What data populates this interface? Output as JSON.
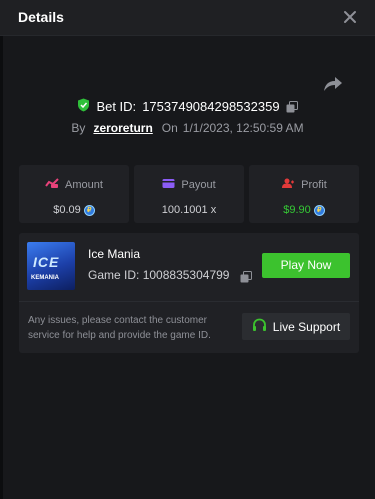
{
  "header": {
    "title": "Details"
  },
  "bet": {
    "label": "Bet ID:",
    "id": "1753749084298532359",
    "by_label": "By",
    "user": "zeroreturn",
    "on_label": "On",
    "datetime": "1/1/2023, 12:50:59 AM"
  },
  "stats": [
    {
      "label": "Amount",
      "value": "$0.09",
      "icon": "money-icon",
      "color": "#e8427a"
    },
    {
      "label": "Payout",
      "value": "100.1001 x",
      "icon": "wallet-icon",
      "color": "#8b5cf6"
    },
    {
      "label": "Profit",
      "value": "$9.90",
      "icon": "user-profit-icon",
      "color": "#e23a3a"
    }
  ],
  "game": {
    "thumb_title": "ICE",
    "thumb_sub": "KEMANIA",
    "name": "Ice Mania",
    "id_label": "Game ID:",
    "id": "1008835304799",
    "play_label": "Play Now",
    "note": "Any issues, please contact the customer service for help and provide the game ID.",
    "support_label": "Live Support"
  },
  "colors": {
    "accent_green": "#3cc22e",
    "profit_green": "#35c935",
    "verified_green": "#2fbf3a"
  }
}
